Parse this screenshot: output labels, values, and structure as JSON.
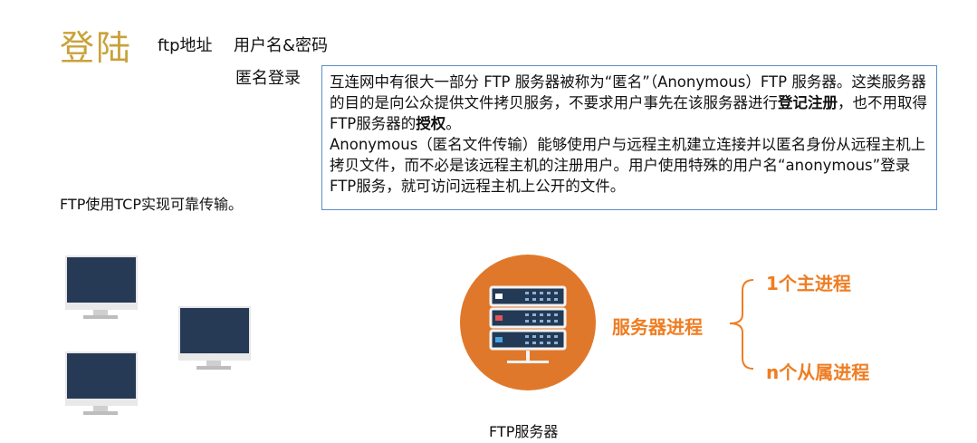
{
  "header": {
    "title": "登陆",
    "ftp_address": "ftp地址",
    "username_password": "用户名&密码",
    "anonymous_login": "匿名登录"
  },
  "description": {
    "p1_a": "互连网中有很大一部分 FTP 服务器被称为“匿名”（Anonymous）FTP 服务器。这类服务器的目的是向公众提供文件拷贝服务，不要求用户事先在该服务器进行",
    "p1_bold1": "登记注册",
    "p1_b": "，也不用取得FTP服务器的",
    "p1_bold2": "授权",
    "p1_c": "。",
    "p2": "Anonymous（匿名文件传输）能够使用户与远程主机建立连接并以匿名身份从远程主机上拷贝文件，而不必是该远程主机的注册用户。用户使用特殊的用户名“anonymous”登录FTP服务，就可访问远程主机上公开的文件。"
  },
  "tcp_note": "FTP使用TCP实现可靠传输。",
  "diagram": {
    "server_label": "FTP服务器",
    "process_label": "服务器进程",
    "main_process": "1个主进程",
    "sub_process": "n个从属进程",
    "accent_color": "#ef7d22",
    "circle_color": "#e0782b"
  }
}
